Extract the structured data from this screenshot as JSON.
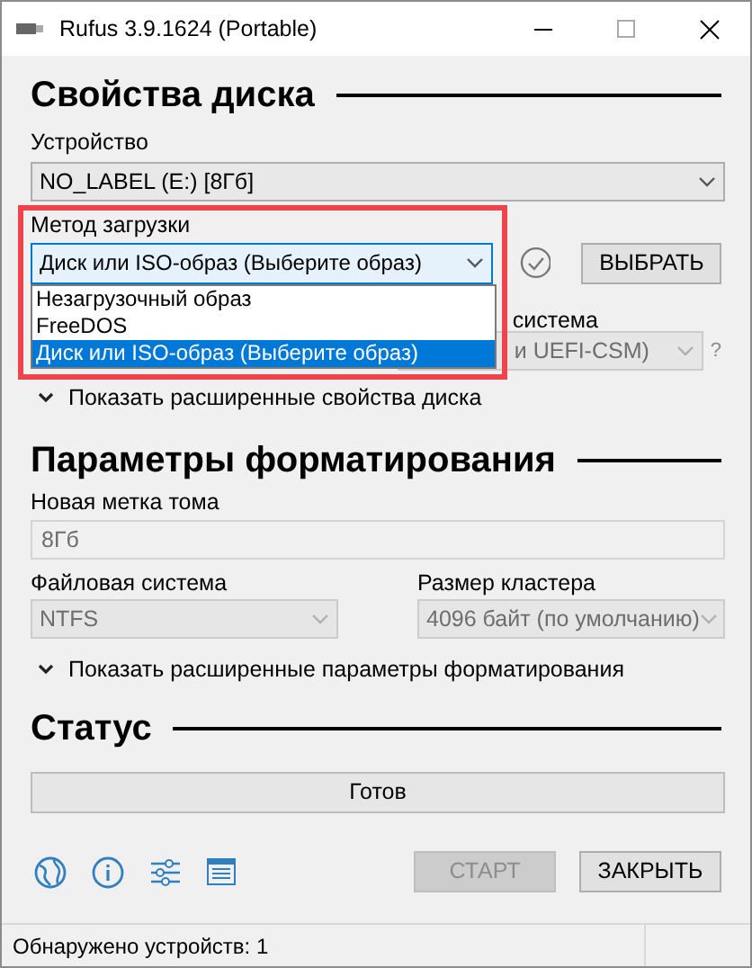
{
  "window": {
    "title": "Rufus 3.9.1624 (Portable)"
  },
  "drive_properties": {
    "heading": "Свойства диска",
    "device": {
      "label": "Устройство",
      "value": "NO_LABEL (E:) [8Гб]"
    },
    "boot_selection": {
      "label": "Метод загрузки",
      "value": "Диск или ISO-образ (Выберите образ)",
      "expanded": true,
      "options": [
        {
          "label": "Незагрузочный образ",
          "selected": false
        },
        {
          "label": "FreeDOS",
          "selected": false
        },
        {
          "label": "Диск или ISO-образ (Выберите образ)",
          "selected": true
        }
      ],
      "select_button": "ВЫБРАТЬ"
    },
    "target_system": {
      "label": "система",
      "value": "и UEFI-CSM)",
      "help": "?",
      "disabled": true
    },
    "advanced_toggle": "Показать расширенные свойства диска"
  },
  "format_options": {
    "heading": "Параметры форматирования",
    "volume_label": {
      "label": "Новая метка тома",
      "value": "8Гб",
      "disabled": true
    },
    "file_system": {
      "label": "Файловая система",
      "value": "NTFS",
      "disabled": true
    },
    "cluster_size": {
      "label": "Размер кластера",
      "value": "4096 байт (по умолчанию)",
      "disabled": true
    },
    "advanced_toggle": "Показать расширенные параметры форматирования"
  },
  "status": {
    "heading": "Статус",
    "progress_text": "Готов",
    "buttons": [
      {
        "label": "СТАРТ",
        "disabled": true
      },
      {
        "label": "ЗАКРЫТЬ",
        "disabled": false
      }
    ]
  },
  "status_bar": {
    "text": "Обнаружено устройств: 1"
  }
}
